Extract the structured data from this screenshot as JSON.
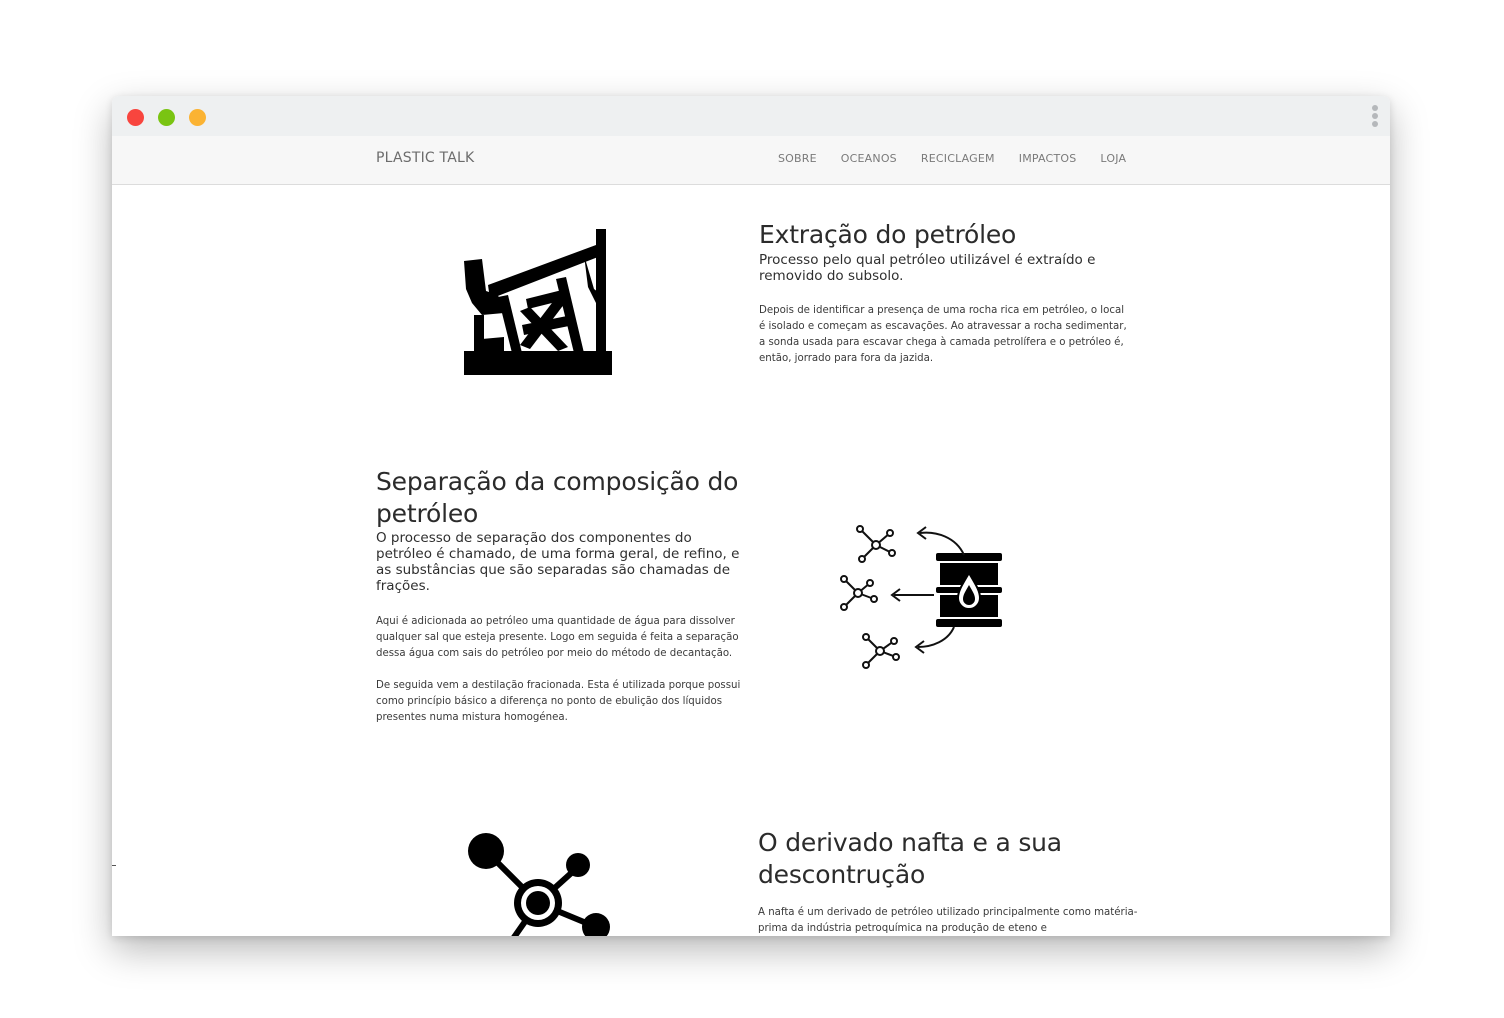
{
  "nav": {
    "brand": "PLASTIC TALK",
    "links": [
      "SOBRE",
      "OCEANOS",
      "RECICLAGEM",
      "IMPACTOS",
      "LOJA"
    ]
  },
  "icons": {
    "pumpjack": "oil-pumpjack-icon",
    "barrel": "oil-barrel-molecules-icon",
    "molecule": "molecule-icon"
  },
  "sections": [
    {
      "title": "Extração do petróleo",
      "lead": "Processo pelo qual petróleo utilizável é extraído e removido do subsolo.",
      "paragraphs": [
        "Depois de identificar a presença de uma rocha rica em petróleo, o local é isolado e começam as escavações. Ao atravessar a rocha sedimentar, a sonda usada para escavar chega à camada petrolífera e o petróleo é, então, jorrado para fora da jazida."
      ]
    },
    {
      "title": "Separação da composição do petróleo",
      "lead": "O processo de separação dos componentes do petróleo é chamado, de uma forma geral, de refino, e as substâncias que são separadas são chamadas de frações.",
      "paragraphs": [
        "Aqui é adicionada ao petróleo uma quantidade de água para dissolver qualquer sal que esteja presente. Logo em seguida é feita a separação dessa água com sais do petróleo por meio do método de decantação.",
        "De seguida vem a destilação fracionada. Esta é utilizada porque possui como princípio básico a diferença no ponto de ebulição dos líquidos presentes numa mistura homogénea."
      ]
    },
    {
      "title": "O derivado nafta e a sua descontrução",
      "lead": "",
      "paragraphs": [
        "A nafta é um derivado de petróleo utilizado principalmente como matéria-prima da indústria petroquímica na produção de eteno e"
      ]
    }
  ]
}
